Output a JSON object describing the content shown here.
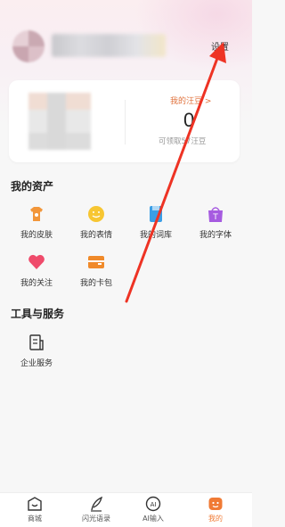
{
  "header": {
    "settings_label": "设置"
  },
  "points_card": {
    "link_label": "我的汪豆 >",
    "value": "0",
    "subtitle": "可领取57汪豆"
  },
  "assets": {
    "title": "我的资产",
    "items": [
      {
        "label": "我的皮肤",
        "icon": "skin-icon"
      },
      {
        "label": "我的表情",
        "icon": "emoji-icon"
      },
      {
        "label": "我的词库",
        "icon": "dictionary-icon"
      },
      {
        "label": "我的字体",
        "icon": "font-icon"
      },
      {
        "label": "我的关注",
        "icon": "heart-icon"
      },
      {
        "label": "我的卡包",
        "icon": "card-wallet-icon"
      }
    ]
  },
  "tools": {
    "title": "工具与服务",
    "items": [
      {
        "label": "企业服务",
        "icon": "enterprise-icon"
      }
    ]
  },
  "tabbar": {
    "items": [
      {
        "label": "商城",
        "icon": "store-icon"
      },
      {
        "label": "闪光语录",
        "icon": "quill-icon"
      },
      {
        "label": "AI输入",
        "icon": "ai-icon"
      },
      {
        "label": "我的",
        "icon": "profile-icon"
      }
    ],
    "active_color": "#f07a34"
  },
  "colors": {
    "accent": "#f07a34",
    "annotation_arrow": "#ee3324"
  }
}
